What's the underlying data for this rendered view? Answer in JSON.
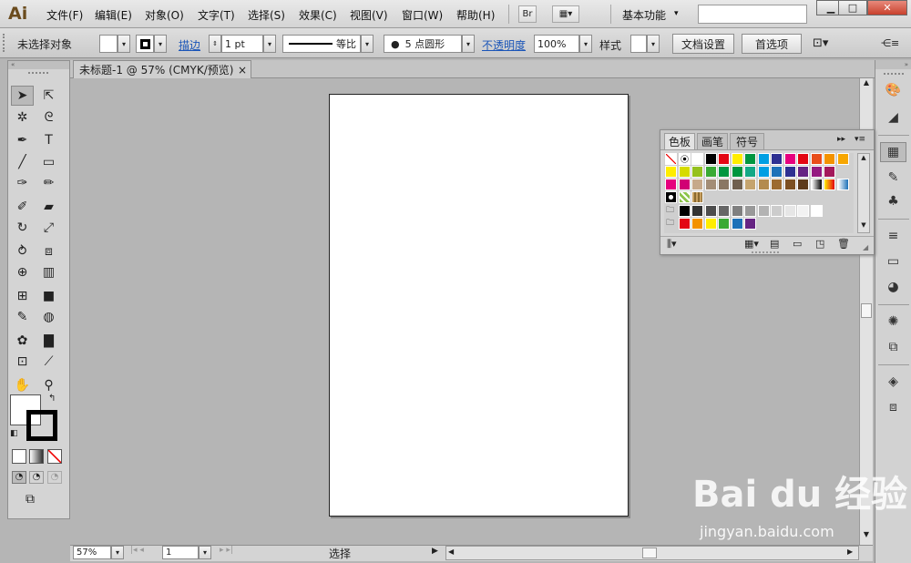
{
  "app": {
    "logo": "Ai"
  },
  "menu": [
    "文件(F)",
    "编辑(E)",
    "对象(O)",
    "文字(T)",
    "选择(S)",
    "效果(C)",
    "视图(V)",
    "窗口(W)",
    "帮助(H)"
  ],
  "menubar": {
    "bridge_label": "Br",
    "workspace": "基本功能",
    "search_value": ""
  },
  "window_buttons": {
    "minimize": "▁",
    "maximize": "□",
    "close": "✕"
  },
  "control": {
    "selection_status": "未选择对象",
    "stroke_label": "描边",
    "stroke_weight": "1 pt",
    "profile_label": "等比",
    "brush_label": "5 点圆形",
    "opacity_label": "不透明度",
    "opacity_value": "100%",
    "style_label": "样式",
    "doc_setup": "文档设置",
    "preferences": "首选项"
  },
  "document": {
    "tab_title": "未标题-1 @ 57% (CMYK/预览)",
    "close": "×"
  },
  "status": {
    "zoom": "57%",
    "artboard_num": "1",
    "status_text": "选择"
  },
  "swatch_panel": {
    "tabs": [
      "色板",
      "画笔",
      "符号"
    ],
    "active_tab": "色板",
    "rows": [
      [
        "none",
        "reg",
        "#ffffff",
        "#000000",
        "#e30613",
        "#ffed00",
        "#00963f",
        "#009fe3",
        "#2e3092",
        "#e6007e",
        "#e30613",
        "#e94e1b",
        "#f39200",
        "#f7a600"
      ],
      [
        "#ffed00",
        "#d6db00",
        "#95c11f",
        "#3aaa35",
        "#009640",
        "#00963f",
        "#13a886",
        "#009fe3",
        "#1d71b8",
        "#2e3092",
        "#662483",
        "#951b81",
        "#a3195b"
      ],
      [
        "#e6007e",
        "#d10074",
        "#c6a98a",
        "#a38d76",
        "#8a7763",
        "#6f5f4e",
        "#c5a46e",
        "#b38b4e",
        "#9c6b30",
        "#7c4f21",
        "#5e3a1a",
        "grad1",
        "grad2",
        "grad3"
      ],
      [
        "pat1",
        "pat2",
        "pat3"
      ],
      [
        "folder",
        "#000000",
        "#333333",
        "#4d4d4d",
        "#666666",
        "#808080",
        "#999999",
        "#b3b3b3",
        "#cccccc",
        "#e6e6e6",
        "#f2f2f2",
        "#ffffff"
      ],
      [
        "folder",
        "#e30613",
        "#f39200",
        "#ffed00",
        "#3aaa35",
        "#1d71b8",
        "#662483"
      ]
    ]
  },
  "tools": [
    "selection-tool",
    "direct-selection-tool",
    "magic-wand-tool",
    "lasso-tool",
    "pen-tool",
    "type-tool",
    "line-tool",
    "rectangle-tool",
    "paintbrush-tool",
    "pencil-tool",
    "blob-brush-tool",
    "eraser-tool",
    "rotate-tool",
    "scale-tool",
    "warp-tool",
    "free-transform-tool",
    "shape-builder-tool",
    "perspective-grid-tool",
    "mesh-tool",
    "gradient-tool",
    "eyedropper-tool",
    "blend-tool",
    "symbol-sprayer-tool",
    "column-graph-tool",
    "artboard-tool",
    "slice-tool",
    "hand-tool",
    "zoom-tool"
  ],
  "watermark": {
    "brand": "Bai du 经验",
    "url": "jingyan.baidu.com"
  }
}
